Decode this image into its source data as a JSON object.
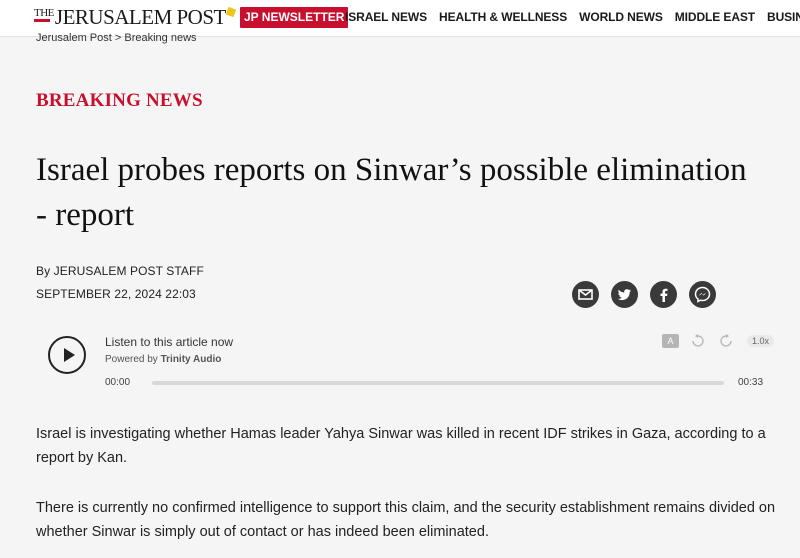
{
  "header": {
    "logo_the": "THE",
    "logo_text": "JERUSALEM POST",
    "newsletter_label": "JP NEWSLETTER",
    "nav": [
      "ISRAEL NEWS",
      "HEALTH & WELLNESS",
      "WORLD NEWS",
      "MIDDLE EAST",
      "BUSINESS & IN"
    ]
  },
  "breadcrumb": {
    "home": "Jerusalem Post",
    "separator": ">",
    "current": "Breaking news"
  },
  "article": {
    "section": "BREAKING NEWS",
    "headline": "Israel probes reports on Sinwar’s possible elimination - report",
    "byline": "By JERUSALEM POST STAFF",
    "date": "SEPTEMBER 22, 2024 22:03",
    "share_icons": [
      "email-icon",
      "twitter-icon",
      "facebook-icon",
      "messenger-icon"
    ],
    "paragraphs": [
      "Israel is investigating whether Hamas leader Yahya Sinwar was killed in recent IDF strikes in Gaza, according to a report by Kan.",
      "There is currently no confirmed intelligence to support this claim, and the security establishment remains divided on whether Sinwar is simply out of contact or has indeed been eliminated."
    ]
  },
  "player": {
    "listen_label": "Listen to this article now",
    "powered_prefix": "Powered by",
    "powered_brand": "Trinity Audio",
    "time_start": "00:00",
    "time_end": "00:33",
    "speed": "1.0x",
    "progress": 0
  },
  "colors": {
    "accent": "#c8102e",
    "icon_dark": "#3a3a3a"
  }
}
